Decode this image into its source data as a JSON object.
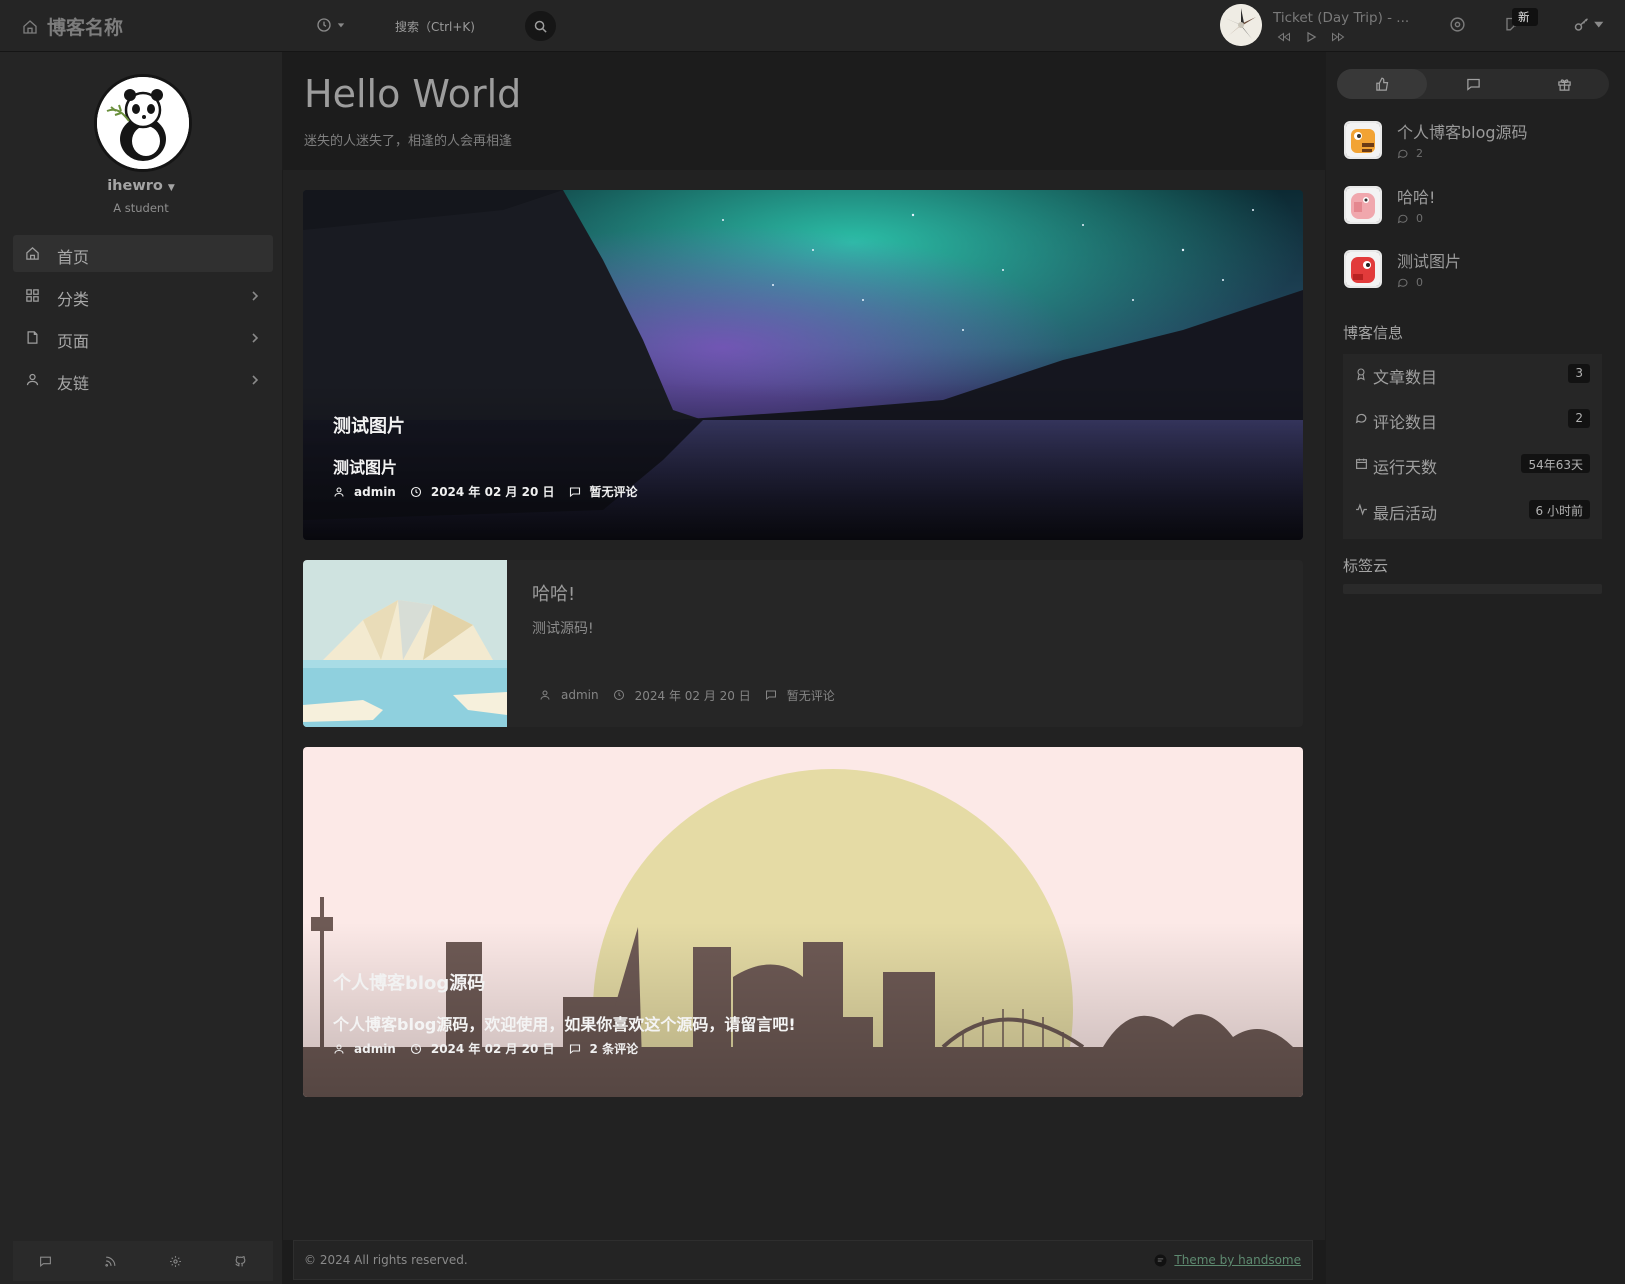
{
  "header": {
    "brand": "博客名称",
    "search_placeholder": "搜索（Ctrl+K)",
    "player": {
      "title": "Ticket (Day Trip) - ..."
    },
    "badge_label": "新"
  },
  "sidebar": {
    "user": {
      "name": "ihewro",
      "role": "A student"
    },
    "nav": [
      {
        "label": "首页",
        "icon": "home-icon",
        "active": true,
        "has_children": false
      },
      {
        "label": "分类",
        "icon": "grid-icon",
        "active": false,
        "has_children": true
      },
      {
        "label": "页面",
        "icon": "file-icon",
        "active": false,
        "has_children": true
      },
      {
        "label": "友链",
        "icon": "user-icon",
        "active": false,
        "has_children": true
      }
    ],
    "footer_icons": [
      "comment-icon",
      "rss-icon",
      "settings-icon",
      "github-icon"
    ]
  },
  "main": {
    "title": "Hello World",
    "subtitle": "迷失的人迷失了，相逢的人会再相逢",
    "posts": [
      {
        "title": "测试图片",
        "excerpt": "测试图片",
        "author": "admin",
        "date": "2024 年 02 月 20 日",
        "comments": "暂无评论"
      },
      {
        "title": "哈哈!",
        "excerpt": "测试源码!",
        "author": "admin",
        "date": "2024 年 02 月 20 日",
        "comments": "暂无评论"
      },
      {
        "title": "个人博客blog源码",
        "excerpt": "个人博客blog源码，欢迎使用，如果你喜欢这个源码，请留言吧!",
        "author": "admin",
        "date": "2024 年 02 月 20 日",
        "comments": "2 条评论"
      }
    ]
  },
  "footer": {
    "copyright": "© 2024 All rights reserved.",
    "credit": "Theme by handsome"
  },
  "right": {
    "tabs": [
      "thumbs-up-icon",
      "comment-icon",
      "gift-icon"
    ],
    "hot_posts": [
      {
        "title": "个人博客blog源码",
        "comments": "2"
      },
      {
        "title": "哈哈!",
        "comments": "0"
      },
      {
        "title": "测试图片",
        "comments": "0"
      }
    ],
    "blog_info_title": "博客信息",
    "blog_info": [
      {
        "label": "文章数目",
        "value": "3",
        "icon": "award-icon"
      },
      {
        "label": "评论数目",
        "value": "2",
        "icon": "comment-icon"
      },
      {
        "label": "运行天数",
        "value": "54年63天",
        "icon": "calendar-icon"
      },
      {
        "label": "最后活动",
        "value": "6 小时前",
        "icon": "activity-icon"
      }
    ],
    "tag_cloud_title": "标签云"
  },
  "colors": {
    "background": "#1c1c1c",
    "panel": "#222222",
    "sidebar": "#252525",
    "link": "#5e8a70"
  }
}
